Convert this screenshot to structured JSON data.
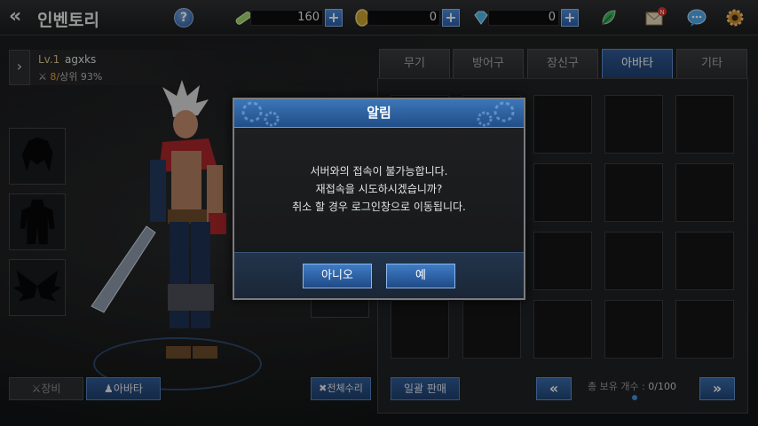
{
  "header": {
    "title": "인벤토리",
    "currencies": [
      {
        "name": "stamina",
        "value": "160"
      },
      {
        "name": "gold",
        "value": "0"
      },
      {
        "name": "gem",
        "value": "0"
      }
    ],
    "mail_badge": "N"
  },
  "character": {
    "level": "Lv.1",
    "name": "agxks",
    "rank_num": "8/",
    "rank_text": "상위 93%"
  },
  "left_tabs": {
    "equip": "장비",
    "avatar": "아바타",
    "repair_all": "전체수리"
  },
  "inventory": {
    "tabs": [
      {
        "label": "무기"
      },
      {
        "label": "방어구"
      },
      {
        "label": "장신구"
      },
      {
        "label": "아바타"
      },
      {
        "label": "기타"
      }
    ],
    "active_tab": "아바타",
    "bulk_sell": "일괄 판매",
    "count_label": "총 보유 개수 : ",
    "count_value": "0/100"
  },
  "dialog": {
    "title": "알림",
    "lines": [
      "서버와의 접속이 불가능합니다.",
      "재접속을 시도하시겠습니까?",
      "취소 할 경우 로그인창으로 이동됩니다."
    ],
    "no_label": "아니오",
    "yes_label": "예"
  },
  "colors": {
    "accent": "#2f5a93",
    "dialog_header": "#3d76b8",
    "gold_text": "#e3a33a"
  },
  "icons": [
    "back-chevrons-icon",
    "help-icon",
    "stamina-icon",
    "gold-coin-icon",
    "gem-icon",
    "leaf-icon",
    "mail-icon",
    "chat-icon",
    "gear-icon"
  ]
}
